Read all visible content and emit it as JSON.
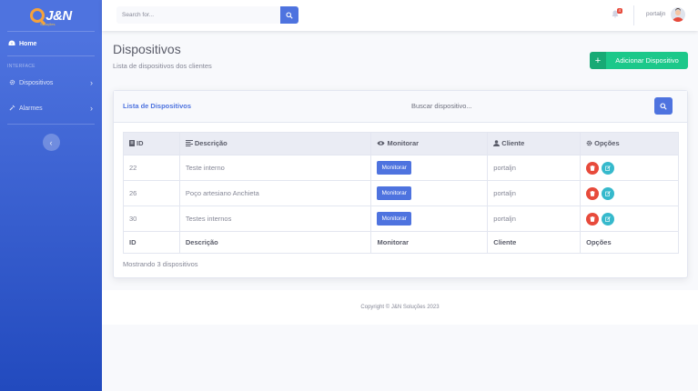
{
  "brand": {
    "name": "J&N",
    "subtitle": "Soluções"
  },
  "sidebar": {
    "items": [
      {
        "label": "Home",
        "icon": "tachometer-icon"
      },
      {
        "label": "Dispositivos",
        "icon": "gear-icon"
      },
      {
        "label": "Alarmes",
        "icon": "wrench-icon"
      }
    ],
    "heading": "INTERFACE"
  },
  "topbar": {
    "search_placeholder": "Search for...",
    "alerts_count": "4",
    "username": "portaljn"
  },
  "page": {
    "title": "Dispositivos",
    "subtitle": "Lista de dispositivos dos clientes",
    "add_button": "Adicionar Dispositivo"
  },
  "card": {
    "title": "Lista de Dispositivos",
    "search_placeholder": "Buscar dispositivo...",
    "columns": [
      "ID",
      "Descrição",
      "Monitorar",
      "Cliente",
      "Opções"
    ],
    "rows": [
      {
        "id": "22",
        "descricao": "Teste interno",
        "monitorar": "Monitorar",
        "cliente": "portaljn"
      },
      {
        "id": "26",
        "descricao": "Poço artesiano Anchieta",
        "monitorar": "Monitorar",
        "cliente": "portaljn"
      },
      {
        "id": "30",
        "descricao": "Testes internos",
        "monitorar": "Monitorar",
        "cliente": "portaljn"
      }
    ],
    "footer_columns": [
      "ID",
      "Descrição",
      "Monitorar",
      "Cliente",
      "Opções"
    ],
    "count_text": "Mostrando 3 dispositivos"
  },
  "footer": {
    "copyright": "Copyright © J&N Soluções 2023"
  },
  "colors": {
    "primary": "#4e73df",
    "success": "#1cc88a",
    "danger": "#e74a3b",
    "info": "#36b9cc"
  }
}
